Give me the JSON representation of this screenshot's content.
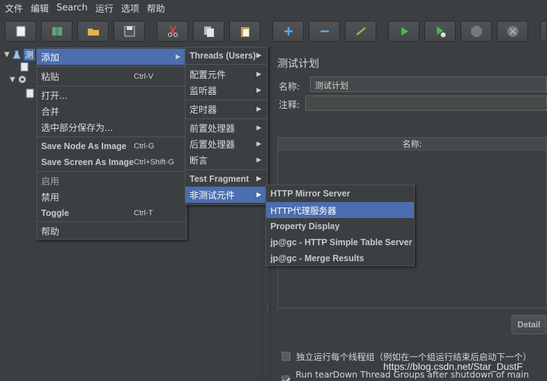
{
  "menubar": [
    "文件",
    "编辑",
    "Search",
    "运行",
    "选项",
    "帮助"
  ],
  "toolbar": [
    {
      "icon": "new-icon"
    },
    {
      "icon": "templates-icon"
    },
    {
      "icon": "open-icon"
    },
    {
      "icon": "save-icon"
    },
    {
      "icon": "cut-icon"
    },
    {
      "icon": "copy-icon"
    },
    {
      "icon": "paste-icon"
    },
    {
      "icon": "expand-icon"
    },
    {
      "icon": "collapse-icon"
    },
    {
      "icon": "toggle-icon"
    },
    {
      "icon": "start-icon"
    },
    {
      "icon": "start-no-pauses-icon"
    },
    {
      "icon": "stop-icon"
    },
    {
      "icon": "shutdown-icon"
    }
  ],
  "tree": {
    "root_label": "测"
  },
  "context_menu": {
    "items": [
      {
        "label": "添加",
        "shortcut": "",
        "submenu": true
      },
      {
        "label": "粘贴",
        "shortcut": "Ctrl-V"
      },
      {
        "label": "打开...",
        "shortcut": ""
      },
      {
        "label": "合并",
        "shortcut": ""
      },
      {
        "label": "选中部分保存为...",
        "shortcut": ""
      },
      {
        "label": "Save Node As Image",
        "shortcut": "Ctrl-G"
      },
      {
        "label": "Save Screen As Image",
        "shortcut": "Ctrl+Shift-G"
      },
      {
        "label": "启用",
        "shortcut": ""
      },
      {
        "label": "禁用",
        "shortcut": ""
      },
      {
        "label": "Toggle",
        "shortcut": "Ctrl-T"
      },
      {
        "label": "帮助",
        "shortcut": ""
      }
    ]
  },
  "add_submenu": {
    "items": [
      {
        "label": "Threads (Users)"
      },
      {
        "label": "配置元件"
      },
      {
        "label": "监听器"
      },
      {
        "label": "定时器"
      },
      {
        "label": "前置处理器"
      },
      {
        "label": "后置处理器"
      },
      {
        "label": "断言"
      },
      {
        "label": "Test Fragment"
      },
      {
        "label": "非测试元件"
      }
    ]
  },
  "non_test_submenu": {
    "items": [
      {
        "label": "HTTP Mirror Server"
      },
      {
        "label": "HTTP代理服务器"
      },
      {
        "label": "Property Display"
      },
      {
        "label": "jp@gc - HTTP Simple Table Server"
      },
      {
        "label": "jp@gc - Merge Results"
      }
    ]
  },
  "panel": {
    "title": "测试计划",
    "name_label": "名称:",
    "name_value": "测试计划",
    "comment_label": "注释:",
    "table_header": "名称:",
    "detail_button": "Detail",
    "checkbox1": "独立运行每个线程组（例如在一个组运行结束后启动下一个）",
    "checkbox2": "Run tearDown Thread Groups after shutdown of main threads"
  },
  "watermark": "https://blog.csdn.net/Star_DustF",
  "colors": {
    "selection": "#4b6eaf",
    "background": "#3c3f41"
  }
}
